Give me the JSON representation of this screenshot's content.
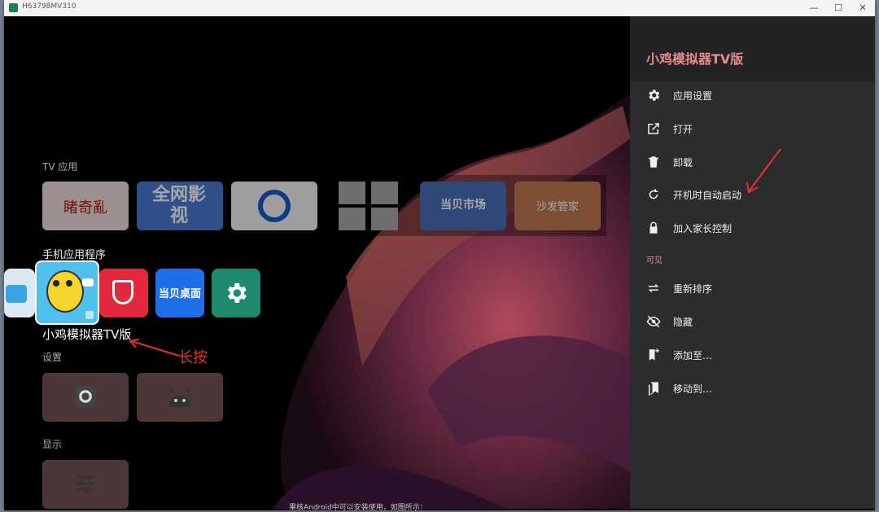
{
  "window": {
    "title": "H63798MV310",
    "minimize": "—",
    "maximize": "☐",
    "close": "✕"
  },
  "launcher": {
    "tv_apps_label": "TV 应用",
    "tv_apps": [
      {
        "name": "cctv",
        "text": "睹奇亂"
      },
      {
        "name": "quanwang",
        "text": "全网影视"
      },
      {
        "name": "browser",
        "text": ""
      },
      {
        "name": "grid",
        "text": ""
      },
      {
        "name": "dangbei-market",
        "text": "当贝市场"
      },
      {
        "name": "sofa-manager",
        "text": "沙发管家"
      }
    ],
    "phone_apps_label": "手机应用程序",
    "phone_apps": [
      {
        "name": "partial-app",
        "text": ""
      },
      {
        "name": "xiaoji",
        "text": ""
      },
      {
        "name": "red-app",
        "text": ""
      },
      {
        "name": "dangbei-desktop",
        "text": "当贝桌面"
      },
      {
        "name": "settings-app",
        "text": ""
      }
    ],
    "focused_app_name": "小鸡模拟器TV版",
    "annotation": "长按",
    "settings_label": "设置",
    "display_label": "显示"
  },
  "menu": {
    "title": "小鸡模拟器TV版",
    "items": [
      {
        "label": "应用设置",
        "icon": "gear-icon"
      },
      {
        "label": "打开",
        "icon": "open-external-icon"
      },
      {
        "label": "卸载",
        "icon": "trash-icon"
      },
      {
        "label": "开机时自动启动",
        "icon": "refresh-icon"
      },
      {
        "label": "加入家长控制",
        "icon": "lock-icon"
      }
    ],
    "visible_section": "可见",
    "items2": [
      {
        "label": "重新排序",
        "icon": "swap-icon"
      },
      {
        "label": "隐藏",
        "icon": "eye-off-icon"
      },
      {
        "label": "添加至…",
        "icon": "bookmark-add-icon"
      },
      {
        "label": "移动到…",
        "icon": "bookmarks-icon"
      }
    ]
  },
  "colors": {
    "accent": "#e68c8c",
    "panel": "#2c2c2e",
    "annotation": "#e23030"
  },
  "bottom_fragment": "果核Android中可以安装使用，如图所示："
}
